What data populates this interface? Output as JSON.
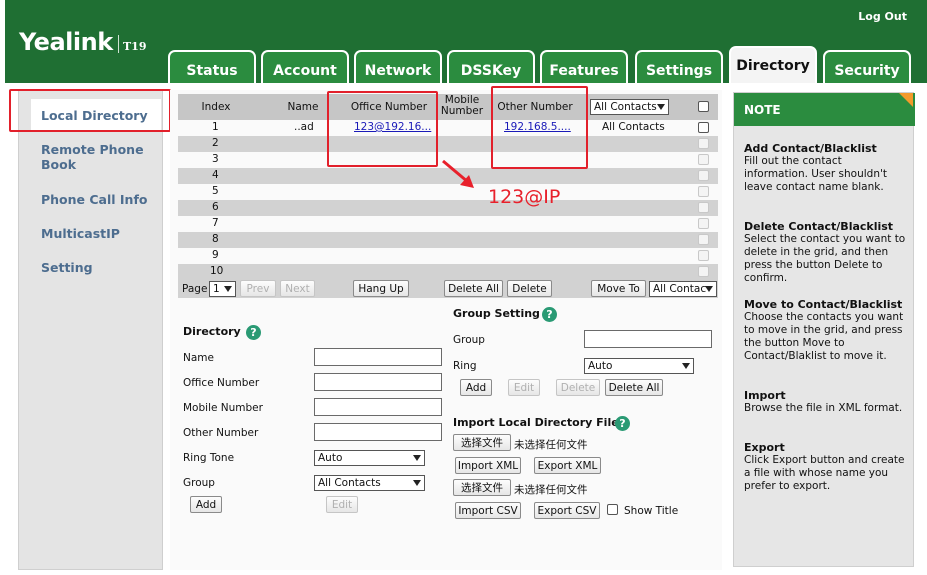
{
  "header": {
    "logo": "Yealink",
    "model": "T19",
    "logout": "Log Out",
    "tabs": [
      "Status",
      "Account",
      "Network",
      "DSSKey",
      "Features",
      "Settings",
      "Directory",
      "Security"
    ],
    "active_tab": "Directory"
  },
  "sidebar": {
    "items": [
      "Local Directory",
      "Remote Phone Book",
      "Phone Call Info",
      "MulticastIP",
      "Setting"
    ],
    "active": "Local Directory"
  },
  "grid": {
    "columns": [
      "Index",
      "Name",
      "Office Number",
      "Mobile Number",
      "Other Number"
    ],
    "group_filter": "All Contacts",
    "rows": [
      {
        "index": "1",
        "name": "..ad",
        "office": "123@192.16...",
        "other": "192.168.5....",
        "group": "All Contacts"
      },
      {
        "index": "2"
      },
      {
        "index": "3"
      },
      {
        "index": "4"
      },
      {
        "index": "5"
      },
      {
        "index": "6"
      },
      {
        "index": "7"
      },
      {
        "index": "8"
      },
      {
        "index": "9"
      },
      {
        "index": "10"
      }
    ],
    "controls": {
      "page_label": "Page",
      "page_value": "1",
      "prev": "Prev",
      "next": "Next",
      "hang_up": "Hang Up",
      "delete_all": "Delete All",
      "delete": "Delete",
      "move_to": "Move To",
      "move_target": "All Contac"
    }
  },
  "annotation": "123@IP",
  "directory_form": {
    "title": "Directory",
    "fields": [
      "Name",
      "Office Number",
      "Mobile Number",
      "Other Number"
    ],
    "ring_tone_label": "Ring Tone",
    "ring_tone_value": "Auto",
    "group_label": "Group",
    "group_value": "All Contacts",
    "add": "Add",
    "edit": "Edit"
  },
  "group_setting": {
    "title": "Group Setting",
    "group_label": "Group",
    "ring_label": "Ring",
    "ring_value": "Auto",
    "add": "Add",
    "edit": "Edit",
    "delete": "Delete",
    "delete_all": "Delete All"
  },
  "import_section": {
    "title": "Import Local Directory File",
    "choose_file": "选择文件",
    "no_file": "未选择任何文件",
    "import_xml": "Import XML",
    "export_xml": "Export XML",
    "import_csv": "Import CSV",
    "export_csv": "Export CSV",
    "show_title": "Show Title"
  },
  "note": {
    "title": "NOTE",
    "sections": [
      {
        "heading": "Add Contact/Blacklist",
        "text": "Fill out the contact information. User shouldn't leave contact name blank."
      },
      {
        "heading": "Delete Contact/Blacklist",
        "text": "Select the contact you want to delete in the grid, and then press the button Delete to confirm."
      },
      {
        "heading": "Move to Contact/Blacklist",
        "text": "Choose the contacts you want to move in the grid, and press the button Move to Contact/Blaklist to move it."
      },
      {
        "heading": "Import",
        "text": "Browse the file in XML format."
      },
      {
        "heading": "Export",
        "text": "Click Export button and create a file with whose name you prefer to export."
      }
    ]
  },
  "colors": {
    "header_green": "#1f6f33",
    "tab_green": "#2b8c3f",
    "highlight_red": "#e2202b",
    "sidebar_link": "#4d6d8f",
    "note_corner": "#f39a2b"
  }
}
